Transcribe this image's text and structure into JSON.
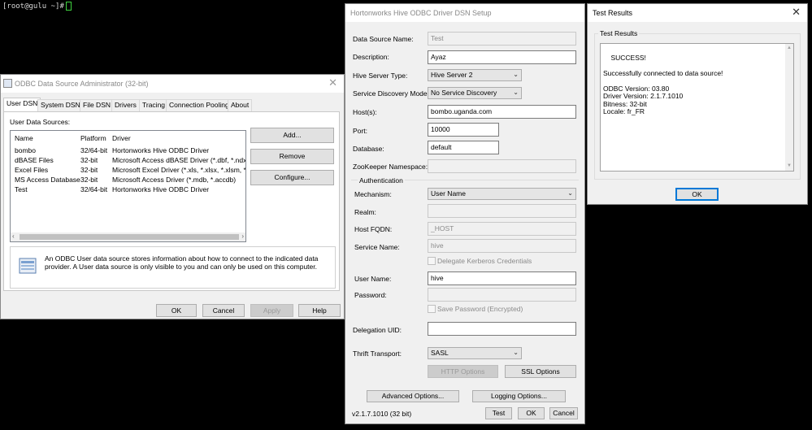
{
  "terminal": {
    "prompt": "[root@gulu ~]#"
  },
  "odbc_admin": {
    "title": "ODBC Data Source Administrator (32-bit)",
    "close": "✕",
    "tabs": [
      "User DSN",
      "System DSN",
      "File DSN",
      "Drivers",
      "Tracing",
      "Connection Pooling",
      "About"
    ],
    "section_label": "User Data Sources:",
    "columns": [
      "Name",
      "Platform",
      "Driver"
    ],
    "rows": [
      {
        "name": "bombo",
        "platform": "32/64-bit",
        "driver": "Hortonworks Hive ODBC Driver"
      },
      {
        "name": "dBASE Files",
        "platform": "32-bit",
        "driver": "Microsoft Access dBASE Driver (*.dbf, *.ndx, *.m"
      },
      {
        "name": "Excel Files",
        "platform": "32-bit",
        "driver": "Microsoft Excel Driver (*.xls, *.xlsx, *.xlsm, *.xlsb"
      },
      {
        "name": "MS Access Database",
        "platform": "32-bit",
        "driver": "Microsoft Access Driver (*.mdb, *.accdb)"
      },
      {
        "name": "Test",
        "platform": "32/64-bit",
        "driver": "Hortonworks Hive ODBC Driver"
      }
    ],
    "buttons": {
      "add": "Add...",
      "remove": "Remove",
      "configure": "Configure..."
    },
    "info_text": "An ODBC User data source stores information about how to connect to the indicated data provider.   A User data source is only visible to you and can only be used on this computer.",
    "footer": {
      "ok": "OK",
      "cancel": "Cancel",
      "apply": "Apply",
      "help": "Help"
    },
    "scroll_left": "‹",
    "scroll_right": "›"
  },
  "hive_setup": {
    "title": "Hortonworks Hive ODBC Driver DSN Setup",
    "fields": {
      "data_source_name": {
        "label": "Data Source Name:",
        "value": "Test"
      },
      "description": {
        "label": "Description:",
        "value": "Ayaz"
      },
      "hive_server_type": {
        "label": "Hive Server Type:",
        "value": "Hive Server 2"
      },
      "service_discovery_mode": {
        "label": "Service Discovery Mode:",
        "value": "No Service Discovery"
      },
      "hosts": {
        "label": "Host(s):",
        "value": "bombo.uganda.com"
      },
      "port": {
        "label": "Port:",
        "value": "10000"
      },
      "database": {
        "label": "Database:",
        "value": "default"
      },
      "zookeeper_namespace": {
        "label": "ZooKeeper Namespace:",
        "value": ""
      }
    },
    "auth": {
      "group_label": "Authentication",
      "mechanism": {
        "label": "Mechanism:",
        "value": "User Name"
      },
      "realm": {
        "label": "Realm:",
        "value": ""
      },
      "host_fqdn": {
        "label": "Host FQDN:",
        "value": "_HOST"
      },
      "service_name": {
        "label": "Service Name:",
        "value": "hive"
      },
      "delegate_kerberos": "Delegate Kerberos Credentials",
      "user_name": {
        "label": "User Name:",
        "value": "hive"
      },
      "password": {
        "label": "Password:",
        "value": ""
      },
      "save_password": "Save Password (Encrypted)"
    },
    "delegation_uid": {
      "label": "Delegation UID:",
      "value": ""
    },
    "thrift_transport": {
      "label": "Thrift Transport:",
      "value": "SASL"
    },
    "buttons": {
      "http_options": "HTTP Options",
      "ssl_options": "SSL Options",
      "advanced_options": "Advanced Options...",
      "logging_options": "Logging Options...",
      "test": "Test",
      "ok": "OK",
      "cancel": "Cancel"
    },
    "version": "v2.1.7.1010 (32 bit)"
  },
  "test_results": {
    "title": "Test Results",
    "close": "✕",
    "group_label": "Test Results",
    "text": "SUCCESS!\n\nSuccessfully connected to data source!\n\nODBC Version: 03.80\nDriver Version: 2.1.7.1010\nBitness: 32-bit\nLocale: fr_FR",
    "ok": "OK"
  },
  "icons": {
    "dropdown": "⌄",
    "chevron": "⌵"
  }
}
